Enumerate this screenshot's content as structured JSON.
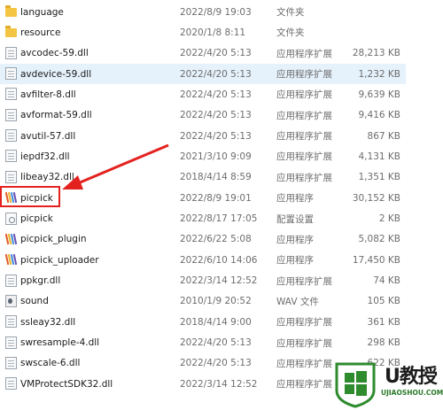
{
  "files": [
    {
      "name": "language",
      "date": "2022/8/9 19:03",
      "type": "文件夹",
      "size": "",
      "icon": "folder-icon"
    },
    {
      "name": "resource",
      "date": "2020/1/8 8:11",
      "type": "文件夹",
      "size": "",
      "icon": "folder-icon"
    },
    {
      "name": "avcodec-59.dll",
      "date": "2022/4/20 5:13",
      "type": "应用程序扩展",
      "size": "28,213 KB",
      "icon": "dll-file-icon"
    },
    {
      "name": "avdevice-59.dll",
      "date": "2022/4/20 5:13",
      "type": "应用程序扩展",
      "size": "1,232 KB",
      "icon": "dll-file-icon"
    },
    {
      "name": "avfilter-8.dll",
      "date": "2022/4/20 5:13",
      "type": "应用程序扩展",
      "size": "9,639 KB",
      "icon": "dll-file-icon"
    },
    {
      "name": "avformat-59.dll",
      "date": "2022/4/20 5:13",
      "type": "应用程序扩展",
      "size": "9,416 KB",
      "icon": "dll-file-icon"
    },
    {
      "name": "avutil-57.dll",
      "date": "2022/4/20 5:13",
      "type": "应用程序扩展",
      "size": "867 KB",
      "icon": "dll-file-icon"
    },
    {
      "name": "iepdf32.dll",
      "date": "2021/3/10 9:09",
      "type": "应用程序扩展",
      "size": "4,131 KB",
      "icon": "dll-file-icon"
    },
    {
      "name": "libeay32.dll",
      "date": "2018/4/14 8:59",
      "type": "应用程序扩展",
      "size": "1,351 KB",
      "icon": "dll-file-icon"
    },
    {
      "name": "picpick",
      "date": "2022/8/9 19:01",
      "type": "应用程序",
      "size": "30,152 KB",
      "icon": "picpick-app-icon"
    },
    {
      "name": "picpick",
      "date": "2022/8/17 17:05",
      "type": "配置设置",
      "size": "2 KB",
      "icon": "config-file-icon"
    },
    {
      "name": "picpick_plugin",
      "date": "2022/6/22 5:08",
      "type": "应用程序",
      "size": "5,082 KB",
      "icon": "picpick-app-icon"
    },
    {
      "name": "picpick_uploader",
      "date": "2022/6/10 14:06",
      "type": "应用程序",
      "size": "17,450 KB",
      "icon": "picpick-app-icon"
    },
    {
      "name": "ppkgr.dll",
      "date": "2022/3/14 12:52",
      "type": "应用程序扩展",
      "size": "74 KB",
      "icon": "dll-file-icon"
    },
    {
      "name": "sound",
      "date": "2010/1/9 20:52",
      "type": "WAV 文件",
      "size": "105 KB",
      "icon": "wav-file-icon"
    },
    {
      "name": "ssleay32.dll",
      "date": "2018/4/14 9:00",
      "type": "应用程序扩展",
      "size": "361 KB",
      "icon": "dll-file-icon"
    },
    {
      "name": "swresample-4.dll",
      "date": "2022/4/20 5:13",
      "type": "应用程序扩展",
      "size": "298 KB",
      "icon": "dll-file-icon"
    },
    {
      "name": "swscale-6.dll",
      "date": "2022/4/20 5:13",
      "type": "应用程序扩展",
      "size": "622 KB",
      "icon": "dll-file-icon"
    },
    {
      "name": "VMProtectSDK32.dll",
      "date": "2022/3/14 12:52",
      "type": "应用程序扩展",
      "size": "",
      "icon": "dll-file-icon"
    }
  ],
  "selected_index": 3,
  "highlighted_index": 9,
  "annotation": {
    "color": "#e3221f"
  },
  "watermark": {
    "title": "U教授",
    "url": "UJIAOSHOU.COM",
    "logo_color": "#2e8b2e"
  }
}
